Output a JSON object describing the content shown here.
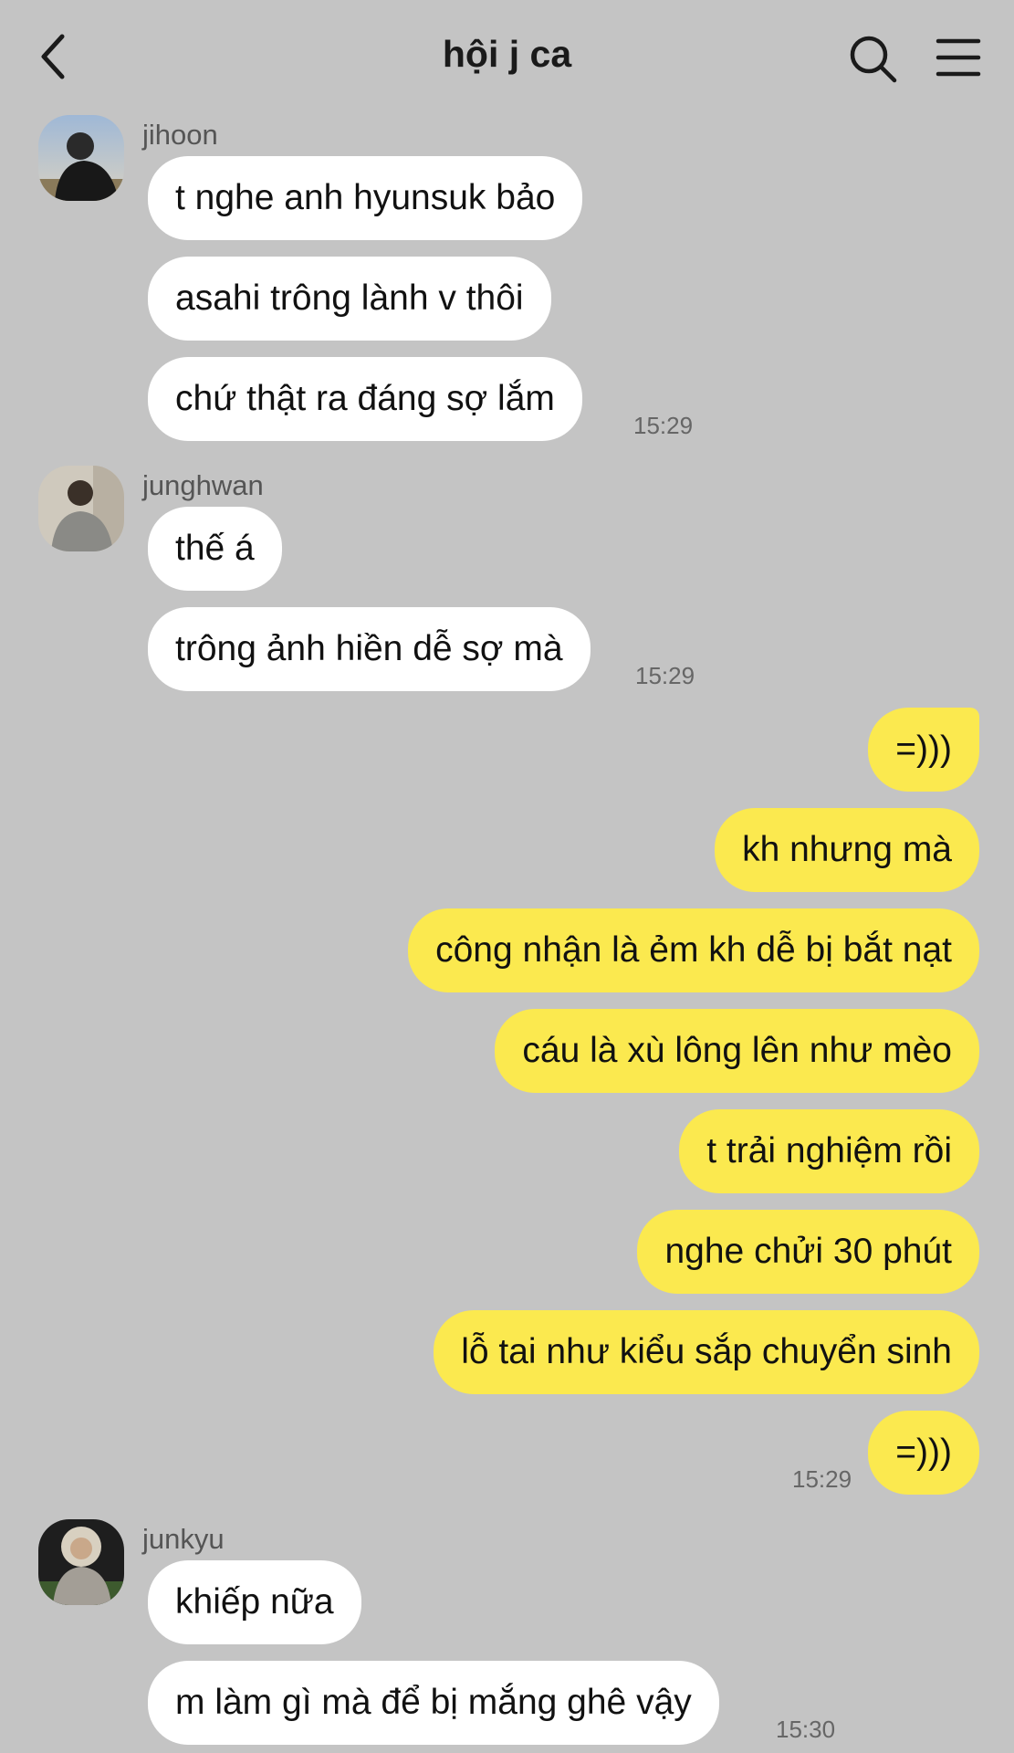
{
  "header": {
    "title": "hội j ca",
    "back_icon": "chevron-left-icon",
    "search_icon": "search-icon",
    "menu_icon": "hamburger-menu-icon"
  },
  "colors": {
    "background": "#c4c4c4",
    "incoming_bubble": "#ffffff",
    "outgoing_bubble": "#fbe94f"
  },
  "groups": [
    {
      "sender": "jihoon",
      "messages": [
        "t nghe anh hyunsuk bảo",
        "asahi trông lành v thôi",
        "chứ thật ra đáng sợ lắm"
      ],
      "time": "15:29"
    },
    {
      "sender": "junghwan",
      "messages": [
        "thế á",
        "trông ảnh hiền dễ sợ mà"
      ],
      "time": "15:29"
    },
    {
      "sender": "me",
      "messages": [
        "=)))",
        "kh nhưng mà",
        "công nhận là ẻm kh dễ bị bắt nạt",
        "cáu là xù lông lên như mèo",
        "t trải nghiệm rồi",
        "nghe chửi 30 phút",
        "lỗ tai như kiểu sắp chuyển sinh",
        "=)))"
      ],
      "time": "15:29"
    },
    {
      "sender": "junkyu",
      "messages": [
        "khiếp nữa",
        "m làm gì mà để bị mắng ghê vậy"
      ],
      "time": "15:30"
    }
  ]
}
